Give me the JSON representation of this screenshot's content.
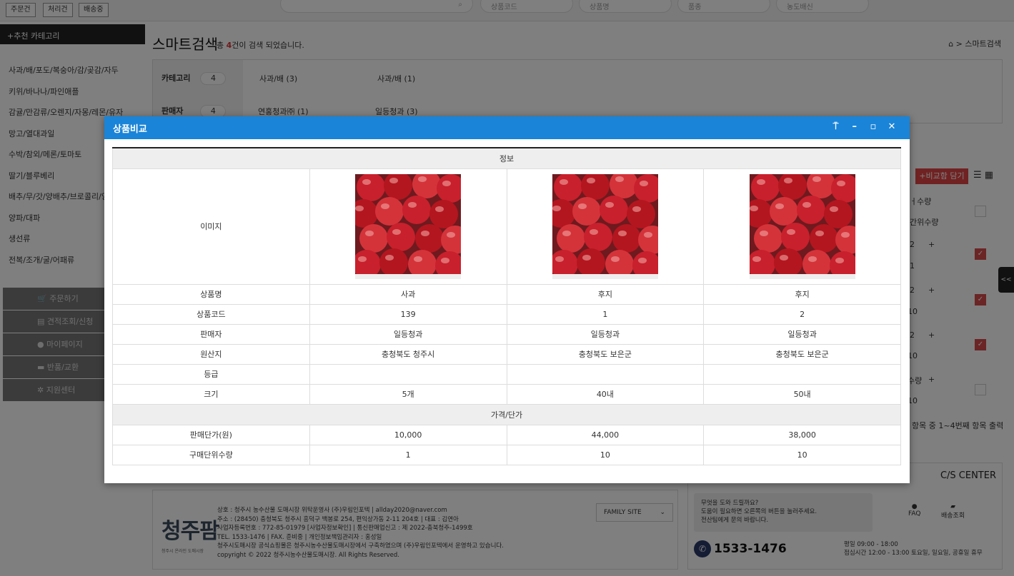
{
  "topbar": {
    "buttons": [
      "주문건",
      "처리건",
      "배송중"
    ],
    "search_fields": [
      "상품코드",
      "상품명",
      "품종",
      "농도배신"
    ]
  },
  "sidebar": {
    "header": "+추천 카테고리",
    "categories": [
      "사과/배/포도/복숭아/감/곶감/자두",
      "키위/바나나/파인애플",
      "감귤/만감류/오렌지/자몽/레몬/유자",
      "망고/열대과일",
      "수박/참외/메론/토마토",
      "딸기/블루베리",
      "배추/무/갓/양배추/브로콜리/양",
      "양파/대파",
      "생선류",
      "전복/조개/굴/어패류"
    ],
    "menu": [
      {
        "icon": "cart-icon",
        "label": "주문하기"
      },
      {
        "icon": "printer-icon",
        "label": "견적조회/신청"
      },
      {
        "icon": "user-icon",
        "label": "마이페이지"
      },
      {
        "icon": "card-icon",
        "label": "반품/교환"
      },
      {
        "icon": "headset-icon",
        "label": "지원센터"
      }
    ]
  },
  "main": {
    "title": "스마트검색",
    "subtitle_pre": "총 ",
    "subtitle_count": "4",
    "subtitle_post": "건이 검색 되었습니다.",
    "breadcrumb_home": "⌂",
    "breadcrumb_sep": ">",
    "breadcrumb_current": "스마트검색",
    "filters": [
      {
        "label": "카테고리",
        "count": "4",
        "options": [
          "사과/배 (3)",
          "사과/배 (1)"
        ]
      },
      {
        "label": "판매자",
        "count": "4",
        "options": [
          "연홍청과㈜ (1)",
          "일등청과 (3)"
        ]
      }
    ],
    "compare_button": "+비교함 담기",
    "right_col": {
      "header_1": "ㅓ수량",
      "header_2": "간위수량",
      "rows": [
        {
          "qty": "2",
          "unit": "1",
          "checked": true
        },
        {
          "qty": "2",
          "unit": "10",
          "checked": true
        },
        {
          "qty": "2",
          "unit": "10",
          "checked": true
        },
        {
          "qty": "수량",
          "unit": "10",
          "checked": false
        }
      ]
    },
    "paging_text": "항목 중 1~4번째 항목 출력",
    "side_tab": "<<"
  },
  "footer": {
    "logo": "청주팜",
    "logo_sub": "청주시 온라인 도매시장",
    "info_lines": [
      "상호 : 청주시 농수산물 도매시장 위탁운영사 (주)우림인포텍 | allday2020@naver.com",
      "주소 : (28450) 충청북도 청주시 흥덕구 백봉로 254, 편익상가동 2-11 204호 | 대표 : 김연아",
      "사업자등록번호 : 772-85-01979 [사업자정보확인] | 통신판매업신고 : 제 2022-충북청주-1499호",
      "TEL. 1533-1476 | FAX. 준비중 | 개인정보책임관리자 : 홍성일",
      "청주시도매시장 공식쇼핑몰은 청주시농수산물도매시장에서 구축하였으며 (주)우림인포텍에서 운영하고 있습니다.",
      "copyright © 2022 청주시농수산물도매시장. All Rights Reserved."
    ],
    "family_site": "FAMILY SITE"
  },
  "cs_center": {
    "title": "C/S CENTER",
    "help_lines": [
      "무엇을 도와 드릴까요?",
      "도움이 필요하면 오른쪽의 버튼을 눌러주세요.",
      "전산팀에게 문의 바랍니다."
    ],
    "faq_label": "FAQ",
    "delivery_label": "배송조회",
    "phone": "1533-1476",
    "hours_1": "평일 09:00 - 18:00",
    "hours_2": "점심시간 12:00 - 13:00 토요일, 일요일, 공휴일 휴무"
  },
  "modal": {
    "title": "상품비교",
    "section_info": "정보",
    "section_price": "가격/단가",
    "row_labels": {
      "image": "이미지",
      "name": "상품명",
      "code": "상품코드",
      "seller": "판매자",
      "origin": "원산지",
      "grade": "등급",
      "size": "크기",
      "price": "판매단가(원)",
      "unit_qty": "구매단위수량"
    },
    "products": [
      {
        "name": "사과",
        "code": "139",
        "seller": "일등청과",
        "origin": "충청북도 청주시",
        "grade": "",
        "size": "5개",
        "price": "10,000",
        "unit_qty": "1"
      },
      {
        "name": "후지",
        "code": "1",
        "seller": "일등청과",
        "origin": "충청북도 보은군",
        "grade": "",
        "size": "40내",
        "price": "44,000",
        "unit_qty": "10"
      },
      {
        "name": "후지",
        "code": "2",
        "seller": "일등청과",
        "origin": "충청북도 보은군",
        "grade": "",
        "size": "50내",
        "price": "38,000",
        "unit_qty": "10"
      }
    ]
  }
}
